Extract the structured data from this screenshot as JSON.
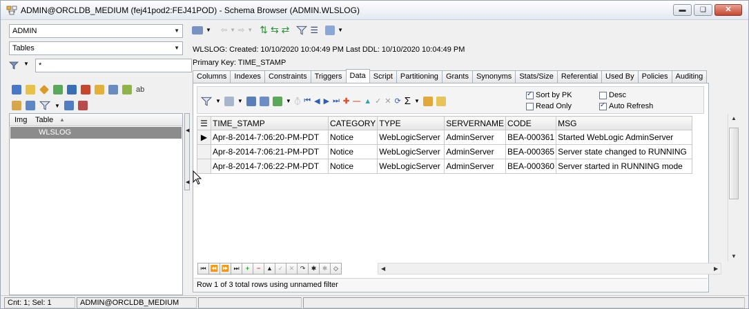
{
  "window": {
    "title": "ADMIN@ORCLDB_MEDIUM (fej41pod2:FEJ41POD) - Schema Browser (ADMIN.WLSLOG)",
    "controls": [
      "minimize-icon",
      "restore-icon",
      "close-icon"
    ]
  },
  "left": {
    "schema_value": "ADMIN",
    "object_type_value": "Tables",
    "filter_value": "*",
    "table_list": {
      "columns": [
        "Img",
        "Table"
      ],
      "sort_indicator": "▲",
      "rows": [
        {
          "table": "WLSLOG"
        }
      ]
    }
  },
  "info": {
    "line1": "WLSLOG:  Created: 10/10/2020 10:04:49 PM   Last DDL: 10/10/2020 10:04:49 PM",
    "line2": "Primary Key:  TIME_STAMP"
  },
  "tabs": [
    "Columns",
    "Indexes",
    "Constraints",
    "Triggers",
    "Data",
    "Script",
    "Partitioning",
    "Grants",
    "Synonyms",
    "Stats/Size",
    "Referential",
    "Used By",
    "Policies",
    "Auditing"
  ],
  "active_tab": "Data",
  "data_options": {
    "sort_by_pk": "Sort by PK",
    "read_only": "Read Only",
    "desc": "Desc",
    "auto_refresh": "Auto Refresh",
    "sigma": "Σ"
  },
  "grid": {
    "columns": [
      "TIME_STAMP",
      "CATEGORY",
      "TYPE",
      "SERVERNAME",
      "CODE",
      "MSG"
    ],
    "rows": [
      [
        "Apr-8-2014-7:06:20-PM-PDT",
        "Notice",
        "WebLogicServer",
        "AdminServer",
        "BEA-000361",
        "Started WebLogic AdminServer"
      ],
      [
        "Apr-8-2014-7:06:21-PM-PDT",
        "Notice",
        "WebLogicServer",
        "AdminServer",
        "BEA-000365",
        "Server state changed to RUNNING"
      ],
      [
        "Apr-8-2014-7:06:22-PM-PDT",
        "Notice",
        "WebLogicServer",
        "AdminServer",
        "BEA-000360",
        "Server started in RUNNING mode"
      ]
    ],
    "current_row_marker": "▶"
  },
  "panel_status": "Row 1 of 3 total rows using unnamed filter",
  "statusbar": {
    "count": "Cnt: 1; Sel: 1",
    "connection": "ADMIN@ORCLDB_MEDIUM"
  }
}
